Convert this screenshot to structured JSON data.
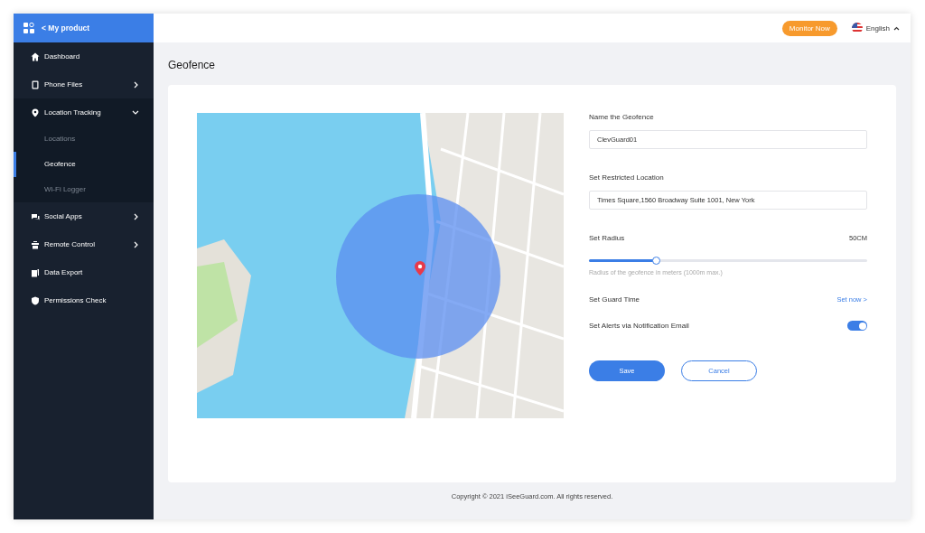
{
  "sidebar": {
    "header": "< My product",
    "items": [
      {
        "label": "Dashboard"
      },
      {
        "label": "Phone Files",
        "expanded": false
      },
      {
        "label": "Location Tracking",
        "expanded": true,
        "children": [
          {
            "label": "Locations",
            "selected": false
          },
          {
            "label": "Geofence",
            "selected": true
          },
          {
            "label": "Wi-Fi Logger",
            "selected": false
          }
        ]
      },
      {
        "label": "Social Apps",
        "expanded": false
      },
      {
        "label": "Remote Control",
        "expanded": false
      },
      {
        "label": "Data Export"
      },
      {
        "label": "Permissions Check"
      }
    ]
  },
  "topbar": {
    "button": "Monitor Now",
    "language": "English"
  },
  "page_title": "Geofence",
  "form": {
    "name_label": "Name the Geofence",
    "name_value": "ClevGuard01",
    "location_label": "Set Restricted Location",
    "location_value": "Times Square,1560 Broadway Suite 1001, New York",
    "radius": {
      "label": "Set Radius",
      "reading": "50CM",
      "level": 0.24,
      "hint": "Radius of the geofence in meters (1000m max.)"
    },
    "guard_label": "Set Guard Time",
    "guard_link": "Set now >",
    "alerts_label": "Set Alerts via Notification Email",
    "alerts_on": true,
    "save": "Save",
    "cancel": "Cancel"
  },
  "footer": "Copyright © 2021 iSeeGuard.com. All rights reserved."
}
